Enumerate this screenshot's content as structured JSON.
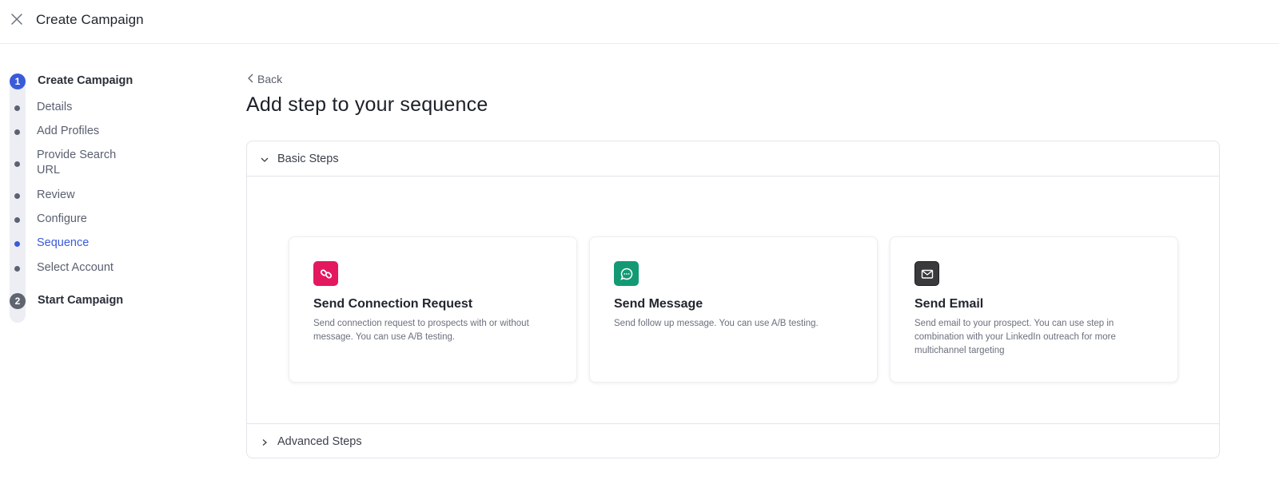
{
  "topbar": {
    "title": "Create Campaign",
    "close_icon": "close-icon"
  },
  "stepper": {
    "steps": [
      {
        "number": "1",
        "label": "Create Campaign",
        "state": "active"
      },
      {
        "number": "2",
        "label": "Start Campaign",
        "state": "pending"
      }
    ],
    "substeps": [
      {
        "label": "Details"
      },
      {
        "label": "Add Profiles"
      },
      {
        "label": "Provide Search URL"
      },
      {
        "label": "Review"
      },
      {
        "label": "Configure"
      },
      {
        "label": "Sequence",
        "current": true
      },
      {
        "label": "Select Account"
      }
    ],
    "active_color": "#3a5bd8"
  },
  "main": {
    "back_label": "Back",
    "title": "Add step to your sequence",
    "basic_steps_label": "Basic Steps",
    "advanced_steps_label": "Advanced Steps",
    "cards": [
      {
        "icon": "link-icon",
        "icon_bg": "#e3185f",
        "title": "Send Connection Request",
        "description": "Send connection request to prospects with or without message. You can use A/B testing."
      },
      {
        "icon": "chat-bubble-icon",
        "icon_bg": "#139a74",
        "title": "Send Message",
        "description": "Send follow up message. You can use A/B testing."
      },
      {
        "icon": "envelope-icon",
        "icon_bg": "#3a3a3c",
        "title": "Send Email",
        "description": "Send email to your prospect. You can use step in combination with your LinkedIn outreach for more multichannel targeting"
      }
    ]
  }
}
